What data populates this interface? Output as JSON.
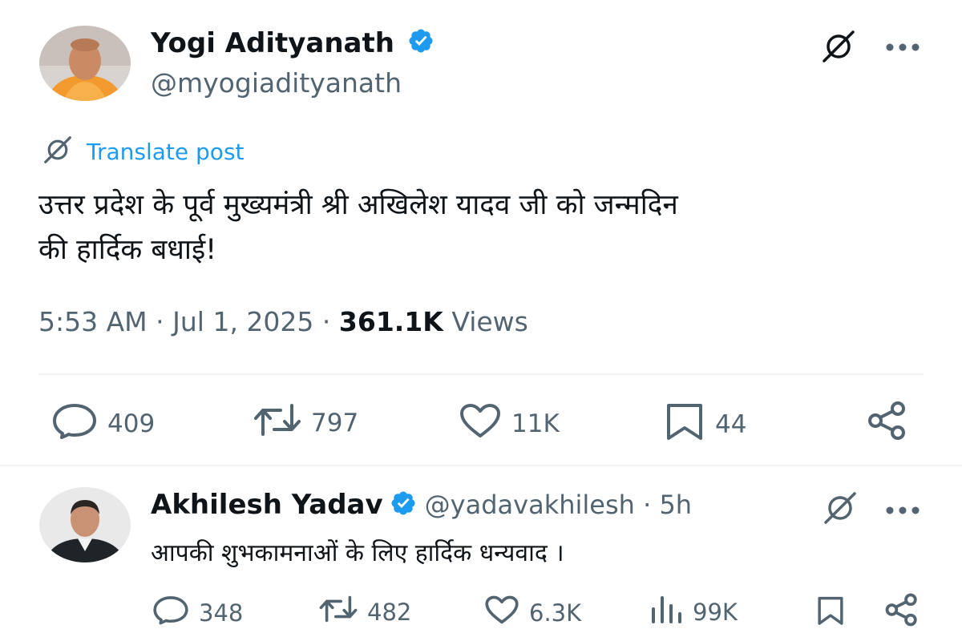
{
  "post": {
    "author_name": "Yogi Adityanath",
    "handle": "@myogiadityanath",
    "translate_label": "Translate post",
    "text_line1": "उत्तर प्रदेश के पूर्व मुख्यमंत्री श्री अखिलेश यादव जी को जन्मदिन",
    "text_line2": "की हार्दिक बधाई!",
    "time": "5:53 AM",
    "date": "Jul 1, 2025",
    "views_count": "361.1K",
    "views_label": "Views",
    "stats": {
      "replies": "409",
      "reposts": "797",
      "likes": "11K",
      "bookmarks": "44"
    }
  },
  "reply": {
    "author_name": "Akhilesh Yadav",
    "handle_time": "@yadavakhilesh · 5h",
    "text": "आपकी शुभकामनाओं के लिए हार्दिक धन्यवाद ।",
    "stats": {
      "replies": "348",
      "reposts": "482",
      "likes": "6.3K",
      "views": "99K"
    }
  },
  "colors": {
    "verified": "#1d9bf0",
    "link": "#1d9bf0",
    "secondary_text": "#536471"
  },
  "icons": [
    "grok-icon",
    "more-icon",
    "verified-badge-icon",
    "translate-icon",
    "reply-icon",
    "repost-icon",
    "like-icon",
    "bookmark-icon",
    "share-icon",
    "views-icon"
  ]
}
